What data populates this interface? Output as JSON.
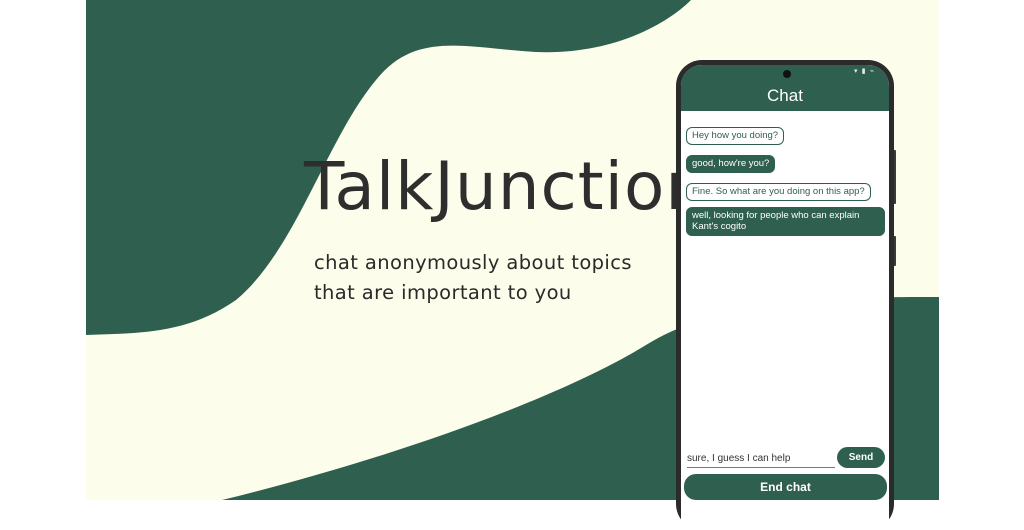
{
  "colors": {
    "brand_green": "#2f5f4f",
    "cream": "#fcfdeb",
    "text_dark": "#2e2e2e"
  },
  "hero": {
    "title": "TalkJunction",
    "tagline_line1": "chat anonymously about topics",
    "tagline_line2": "that are important to you"
  },
  "phone": {
    "status_icons": "▾ ▮ ⌁",
    "app": {
      "title": "Chat",
      "messages": [
        {
          "text": "Hey how you doing?",
          "side": "out"
        },
        {
          "text": "good, how're you?",
          "side": "in"
        },
        {
          "text": "Fine. So what are you doing on this app?",
          "side": "out"
        },
        {
          "text": "well, looking for people who can explain Kant's cogito",
          "side": "in"
        }
      ],
      "input_value": "sure, I guess I can help",
      "send_label": "Send",
      "end_chat_label": "End chat"
    }
  }
}
